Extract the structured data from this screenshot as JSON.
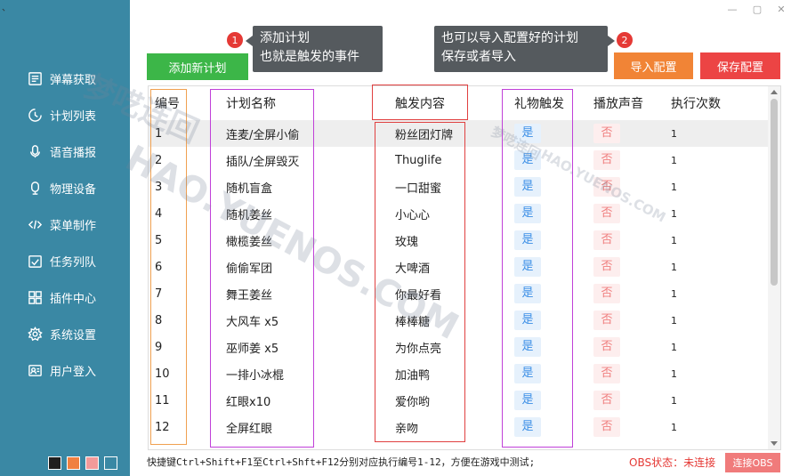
{
  "window": {
    "corner_mark": "、",
    "minimize_glyph": "—",
    "maximize_glyph": "▢",
    "close_glyph": "✕"
  },
  "sidebar": {
    "items": [
      {
        "label": "弹幕获取",
        "icon": "list-icon"
      },
      {
        "label": "计划列表",
        "icon": "plan-icon"
      },
      {
        "label": "语音播报",
        "icon": "microphone-icon"
      },
      {
        "label": "物理设备",
        "icon": "device-icon"
      },
      {
        "label": "菜单制作",
        "icon": "code-icon"
      },
      {
        "label": "任务列队",
        "icon": "task-icon"
      },
      {
        "label": "插件中心",
        "icon": "plugin-icon"
      },
      {
        "label": "系统设置",
        "icon": "gear-icon"
      },
      {
        "label": "用户登入",
        "icon": "user-card-icon"
      }
    ],
    "swatch_colors": [
      "#1f1f1f",
      "#f08040",
      "#f29a9a",
      "#3a88a4"
    ]
  },
  "toolbar": {
    "add_label": "添加新计划",
    "import_label": "导入配置",
    "save_label": "保存配置"
  },
  "tooltips": {
    "badge1": "1",
    "tip1_line1": "添加计划",
    "tip1_line2": "也就是触发的事件",
    "badge2": "2",
    "tip2_line1": "也可以导入配置好的计划",
    "tip2_line2": "保存或者导入"
  },
  "table": {
    "headers": {
      "id": "编号",
      "name": "计划名称",
      "trigger": "触发内容",
      "gift": "礼物触发",
      "sound": "播放声音",
      "count": "执行次数"
    },
    "rows": [
      {
        "id": "1",
        "name": "连麦/全屏小偷",
        "trigger": "粉丝团灯牌",
        "gift": "是",
        "sound": "否",
        "count": "1"
      },
      {
        "id": "2",
        "name": "插队/全屏毁灭",
        "trigger": "Thuglife",
        "gift": "是",
        "sound": "否",
        "count": "1"
      },
      {
        "id": "3",
        "name": "随机盲盒",
        "trigger": "一口甜蜜",
        "gift": "是",
        "sound": "否",
        "count": "1"
      },
      {
        "id": "4",
        "name": "随机姜丝",
        "trigger": "小心心",
        "gift": "是",
        "sound": "否",
        "count": "1"
      },
      {
        "id": "5",
        "name": "橄榄姜丝",
        "trigger": "玫瑰",
        "gift": "是",
        "sound": "否",
        "count": "1"
      },
      {
        "id": "6",
        "name": "偷偷军团",
        "trigger": "大啤酒",
        "gift": "是",
        "sound": "否",
        "count": "1"
      },
      {
        "id": "7",
        "name": "舞王姜丝",
        "trigger": "你最好看",
        "gift": "是",
        "sound": "否",
        "count": "1"
      },
      {
        "id": "8",
        "name": "大风车 x5",
        "trigger": "棒棒糖",
        "gift": "是",
        "sound": "否",
        "count": "1"
      },
      {
        "id": "9",
        "name": "巫师姜 x5",
        "trigger": "为你点亮",
        "gift": "是",
        "sound": "否",
        "count": "1"
      },
      {
        "id": "10",
        "name": "一排小冰棍",
        "trigger": "加油鸭",
        "gift": "是",
        "sound": "否",
        "count": "1"
      },
      {
        "id": "11",
        "name": "红眼x10",
        "trigger": "爱你哟",
        "gift": "是",
        "sound": "否",
        "count": "1"
      },
      {
        "id": "12",
        "name": "全屏红眼",
        "trigger": "亲吻",
        "gift": "是",
        "sound": "否",
        "count": "1"
      }
    ]
  },
  "footer": {
    "shortcut_hint": "快捷键Ctrl+Shift+F1至Ctrl+Shft+F12分别对应执行编号1-12，方便在游戏中测试;",
    "obs_status": "OBS状态：未连接",
    "obs_connect": "连接OBS"
  },
  "watermark": {
    "line1": "梦呓连回",
    "line2": "HAO.YUENOS.COM",
    "small1": "梦呓连回",
    "small2": "HAO.YUENOS.COM"
  },
  "colors": {
    "sidebar": "#3a88a4",
    "add_button": "#3cb648",
    "import_button": "#f18436",
    "save_button": "#ec4444",
    "annotation_orange": "#f0a050",
    "annotation_purple": "#c040d8",
    "annotation_red": "#e04040"
  }
}
